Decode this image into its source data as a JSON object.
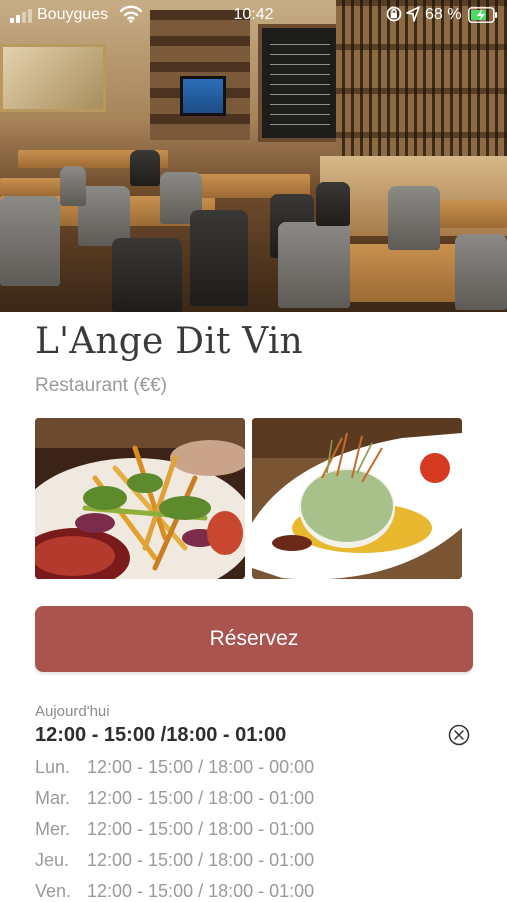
{
  "status_bar": {
    "carrier": "Bouygues",
    "time": "10:42",
    "battery_percent": "68 %"
  },
  "restaurant": {
    "name": "L'Ange Dit Vin",
    "category": "Restaurant (€€)"
  },
  "reserve_button": {
    "label": "Réservez",
    "color": "#a9544f"
  },
  "hours": {
    "today_label": "Aujourd'hui",
    "today_hours": "12:00 - 15:00 /18:00 - 01:00",
    "rows": [
      {
        "day": "Lun.",
        "hours": "12:00 - 15:00 / 18:00 - 00:00"
      },
      {
        "day": "Mar.",
        "hours": "12:00 - 15:00 / 18:00 - 01:00"
      },
      {
        "day": "Mer.",
        "hours": "12:00 - 15:00 / 18:00 - 01:00"
      },
      {
        "day": "Jeu.",
        "hours": "12:00 - 15:00 / 18:00 - 01:00"
      },
      {
        "day": "Ven.",
        "hours": "12:00 - 15:00 / 18:00 - 01:00"
      }
    ]
  },
  "icons": {
    "close": "circle-x-icon",
    "wifi": "wifi-icon",
    "battery": "battery-charging-icon"
  }
}
